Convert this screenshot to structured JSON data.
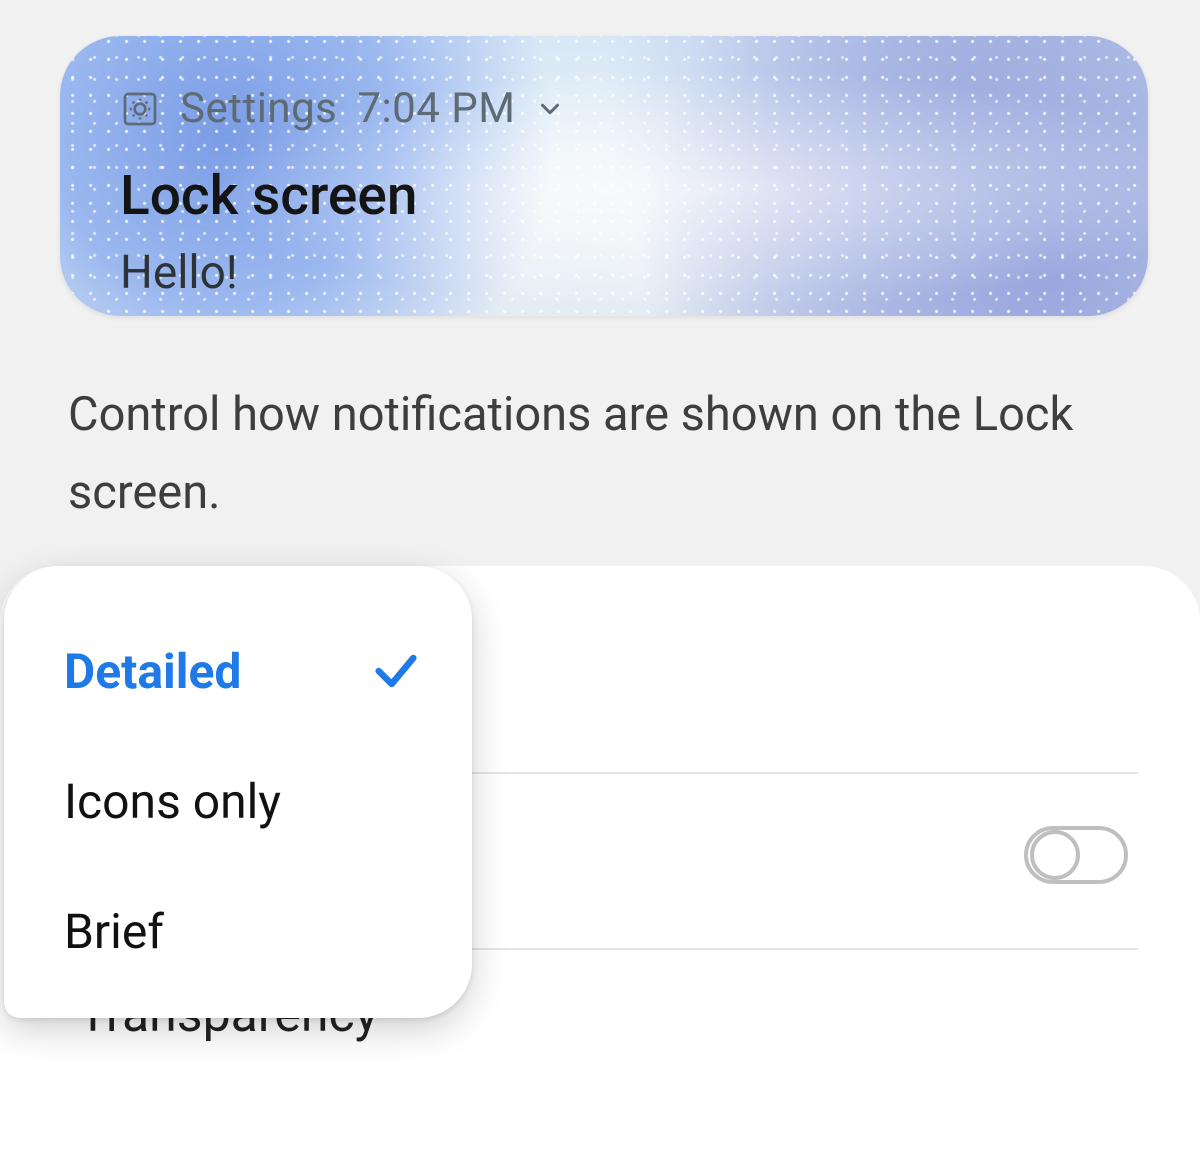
{
  "preview": {
    "app_name": "Settings",
    "time": "7:04 PM",
    "title": "Lock screen",
    "body": "Hello!"
  },
  "description": "Control how notifications are shown on the Lock screen.",
  "popup": {
    "options": [
      {
        "label": "Detailed",
        "selected": true
      },
      {
        "label": "Icons only",
        "selected": false
      },
      {
        "label": "Brief",
        "selected": false
      }
    ]
  },
  "rows": {
    "hidden_toggle": {
      "on": false
    },
    "transparency_label": "Transparency"
  },
  "colors": {
    "accent": "#1f79e6",
    "bg": "#f1f1f1",
    "panel": "#ffffff",
    "text_muted": "#5e6a74"
  }
}
